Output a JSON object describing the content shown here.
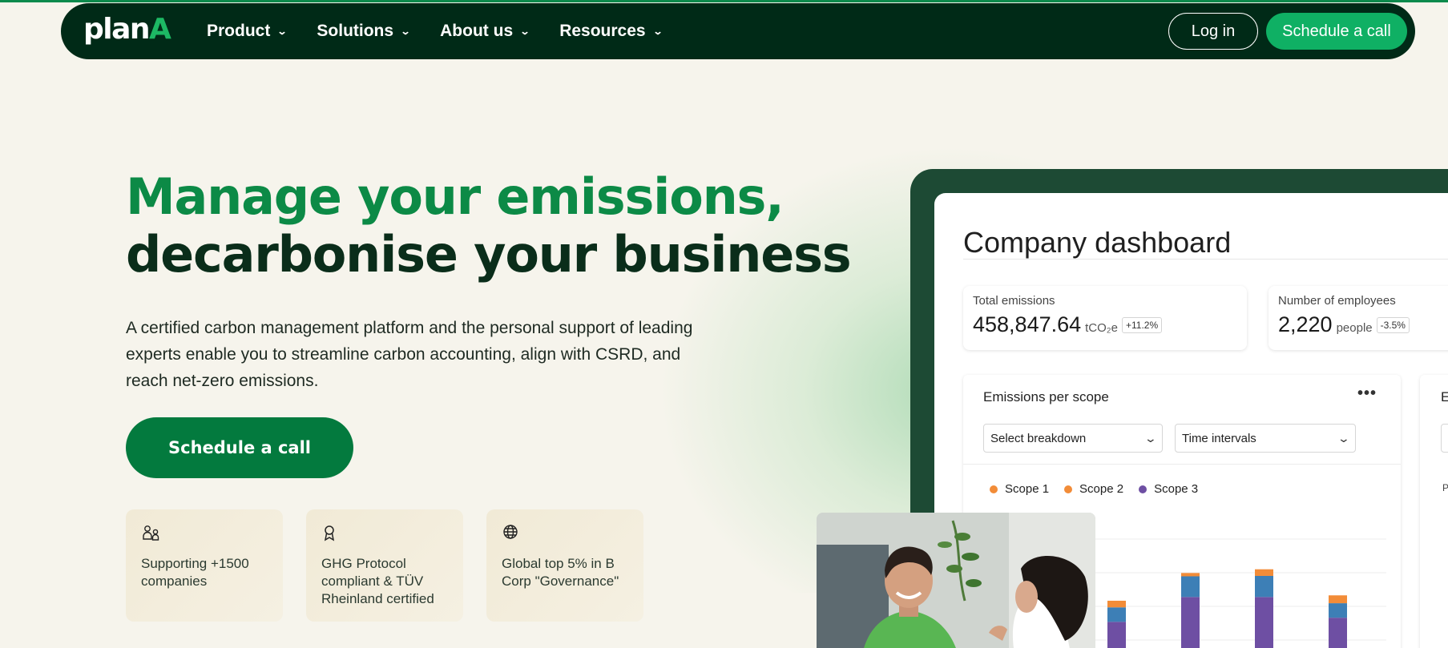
{
  "nav": {
    "logo_main": "plan",
    "logo_accent": "A",
    "items": [
      {
        "label": "Product"
      },
      {
        "label": "Solutions"
      },
      {
        "label": "About us"
      },
      {
        "label": "Resources"
      }
    ],
    "login_label": "Log in",
    "cta_label": "Schedule a call"
  },
  "hero": {
    "headline_line1": "Manage your emissions,",
    "headline_line2": "decarbonise your business",
    "subtitle": "A certified carbon management platform and the personal support of leading experts enable you to streamline carbon accounting, align with CSRD, and reach net-zero emissions.",
    "cta_label": "Schedule a call",
    "features": [
      {
        "icon": "people-icon",
        "text": "Supporting +1500 companies"
      },
      {
        "icon": "award-icon",
        "text": "GHG Protocol compliant & TÜV Rheinland certified"
      },
      {
        "icon": "globe-icon",
        "text": "Global top 5% in B Corp \"Governance\""
      }
    ]
  },
  "dashboard": {
    "title": "Company dashboard",
    "kpis": [
      {
        "label": "Total emissions",
        "value": "458,847.64",
        "unit": "tCO₂e",
        "badge": "+11.2%"
      },
      {
        "label": "Number of employees",
        "value": "2,220",
        "unit": "people",
        "badge": "-3.5%"
      }
    ],
    "panel": {
      "title": "Emissions per scope",
      "more": "•••",
      "select_breakdown": "Select breakdown",
      "select_time": "Time intervals"
    },
    "panel2": {
      "title": "E",
      "label": "P"
    },
    "colors": {
      "scope1": "#f28c38",
      "scope2": "#f28c38",
      "scope3": "#6e4fa3",
      "scope2_bar": "#3d7fb6"
    }
  },
  "chart_data": {
    "type": "bar",
    "stacked": true,
    "categories": [
      "",
      "",
      "",
      ""
    ],
    "series": [
      {
        "name": "Scope 1",
        "values": [
          1.6,
          0.8,
          1.6,
          1.9
        ]
      },
      {
        "name": "Scope 2",
        "values": [
          3.5,
          5.0,
          5.1,
          3.5
        ]
      },
      {
        "name": "Scope 3",
        "values": [
          10,
          16,
          16,
          11
        ]
      }
    ],
    "legend": [
      "Scope 1",
      "Scope 2",
      "Scope 3"
    ],
    "title": "Emissions per scope",
    "xlabel": "",
    "ylabel": "",
    "ylim": [
      0,
      30
    ],
    "grid": true,
    "legend_position": "top-left"
  },
  "photo": {
    "description_icon": "photo-people-meeting-icon"
  }
}
